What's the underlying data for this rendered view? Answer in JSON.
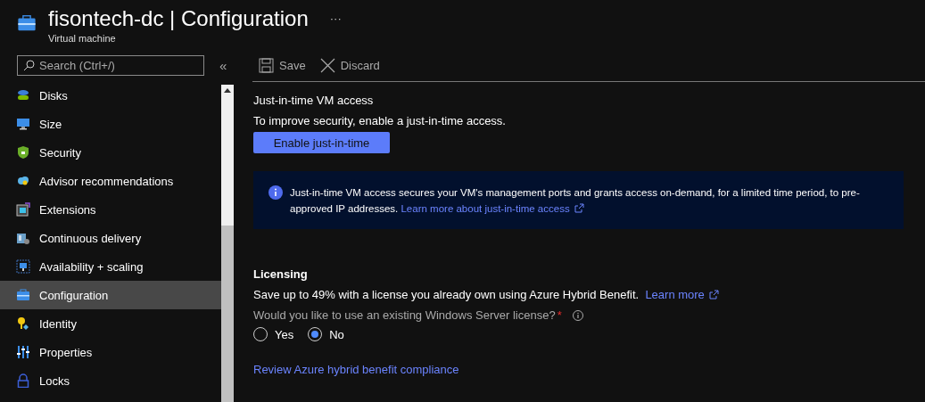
{
  "header": {
    "title": "fisontech-dc | Configuration",
    "subtitle": "Virtual machine",
    "more": "···"
  },
  "search": {
    "placeholder": "Search (Ctrl+/)"
  },
  "collapse": "«",
  "sidebar": {
    "items": [
      {
        "label": "Disks",
        "selected": false
      },
      {
        "label": "Size",
        "selected": false
      },
      {
        "label": "Security",
        "selected": false
      },
      {
        "label": "Advisor recommendations",
        "selected": false
      },
      {
        "label": "Extensions",
        "selected": false
      },
      {
        "label": "Continuous delivery",
        "selected": false
      },
      {
        "label": "Availability + scaling",
        "selected": false
      },
      {
        "label": "Configuration",
        "selected": true
      },
      {
        "label": "Identity",
        "selected": false
      },
      {
        "label": "Properties",
        "selected": false
      },
      {
        "label": "Locks",
        "selected": false
      }
    ]
  },
  "toolbar": [
    {
      "label": "Save",
      "kind": "save"
    },
    {
      "label": "Discard",
      "kind": "discard"
    }
  ],
  "jit": {
    "heading": "Just-in-time VM access",
    "description": "To improve security, enable a just-in-time access.",
    "button": "Enable just-in-time",
    "info": "Just-in-time VM access secures your VM's management ports and grants access on-demand, for a limited time period, to pre-approved IP addresses.",
    "info_link": "Learn more about just-in-time access"
  },
  "licensing": {
    "heading": "Licensing",
    "description": "Save up to 49% with a license you already own using Azure Hybrid Benefit.",
    "link": "Learn more",
    "question": "Would you like to use an existing Windows Server license?",
    "required": "*",
    "options": [
      {
        "label": "Yes",
        "selected": false
      },
      {
        "label": "No",
        "selected": true
      }
    ],
    "review_link": "Review Azure hybrid benefit compliance"
  }
}
